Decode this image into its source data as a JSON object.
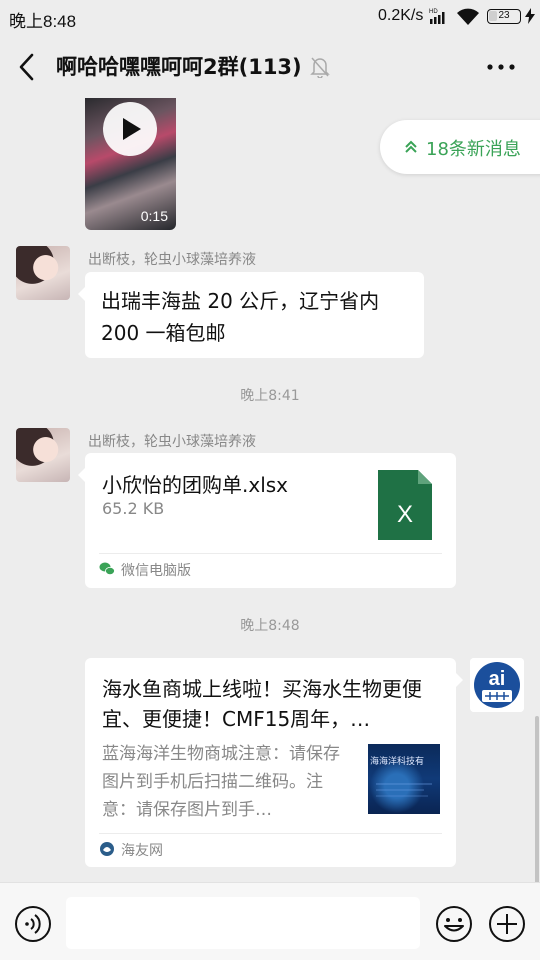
{
  "status_bar": {
    "time": "晚上8:48",
    "network_speed": "0.2K/s",
    "battery_level": "23"
  },
  "header": {
    "title": "啊哈哈嘿嘿呵呵2群(113)"
  },
  "new_messages_pill": {
    "label": "18条新消息"
  },
  "messages": {
    "video": {
      "duration": "0:15"
    },
    "text_msg": {
      "sender": "出断枝，轮虫小球藻培养液",
      "text": "出瑞丰海盐 20 公斤，辽宁省内 200 一箱包邮"
    },
    "divider_1": "晚上8:41",
    "file_msg": {
      "sender": "出断枝，轮虫小球藻培养液",
      "file_name": "小欣怡的团购单.xlsx",
      "file_size": "65.2 KB",
      "source": "微信电脑版",
      "file_icon_letter": "X"
    },
    "divider_2": "晚上8:48",
    "link_msg": {
      "title": "海水鱼商城上线啦！买海水生物更便宜、更便捷！CMF15周年，…",
      "description": "蓝海海洋生物商城注意：请保存图片到手机后扫描二维码。注意：请保存图片到手…",
      "thumb_text": "海海洋科技有",
      "source": "海友网"
    }
  },
  "colors": {
    "accent_green": "#3aa357",
    "excel_green": "#1f7145",
    "background": "#ededed"
  }
}
